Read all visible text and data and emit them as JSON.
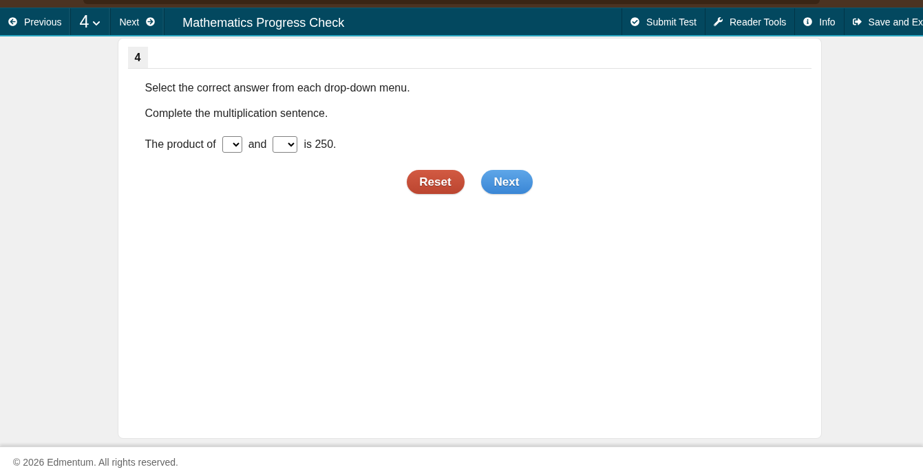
{
  "toolbar": {
    "nav": [
      {
        "kind": "previous",
        "label": "Previous"
      },
      {
        "kind": "question",
        "label": "4"
      },
      {
        "kind": "next",
        "label": "Next"
      }
    ],
    "title": "Mathematics Progress Check",
    "actions": [
      {
        "kind": "submit",
        "label": "Submit Test"
      },
      {
        "kind": "tools",
        "label": "Reader Tools"
      },
      {
        "kind": "info",
        "label": "Info"
      },
      {
        "kind": "exit",
        "label": "Save and Ex"
      }
    ]
  },
  "question": {
    "number": "4",
    "instructions": [
      "Select the correct answer from each drop-down menu.",
      "Complete the multiplication sentence."
    ],
    "sentence": [
      {
        "kind": "text",
        "text": "The product of"
      },
      {
        "kind": "dropdown"
      },
      {
        "kind": "text",
        "text": "and"
      },
      {
        "kind": "dropdown"
      },
      {
        "kind": "text",
        "text": "is 250."
      }
    ],
    "buttons": [
      {
        "kind": "reset",
        "label": "Reset"
      },
      {
        "kind": "next",
        "label": "Next"
      }
    ]
  },
  "footer": {
    "copyright": "© 2026 Edmentum. All rights reserved."
  }
}
